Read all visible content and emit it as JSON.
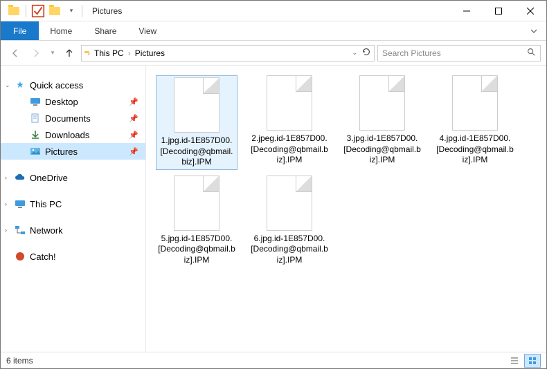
{
  "window": {
    "title": "Pictures"
  },
  "ribbon": {
    "file": "File",
    "tabs": [
      "Home",
      "Share",
      "View"
    ]
  },
  "breadcrumb": {
    "items": [
      "This PC",
      "Pictures"
    ]
  },
  "search": {
    "placeholder": "Search Pictures"
  },
  "tree": {
    "quick_access": {
      "label": "Quick access",
      "items": [
        {
          "label": "Desktop",
          "pinned": true
        },
        {
          "label": "Documents",
          "pinned": true
        },
        {
          "label": "Downloads",
          "pinned": true
        },
        {
          "label": "Pictures",
          "pinned": true,
          "selected": true
        }
      ]
    },
    "onedrive": {
      "label": "OneDrive"
    },
    "this_pc": {
      "label": "This PC"
    },
    "network": {
      "label": "Network"
    },
    "catch": {
      "label": "Catch!"
    }
  },
  "files": [
    {
      "name": "1.jpg.id-1E857D00.[Decoding@qbmail.biz].IPM"
    },
    {
      "name": "2.jpeg.id-1E857D00.[Decoding@qbmail.biz].IPM"
    },
    {
      "name": "3.jpg.id-1E857D00.[Decoding@qbmail.biz].IPM"
    },
    {
      "name": "4.jpg.id-1E857D00.[Decoding@qbmail.biz].IPM"
    },
    {
      "name": "5.jpg.id-1E857D00.[Decoding@qbmail.biz].IPM"
    },
    {
      "name": "6.jpg.id-1E857D00.[Decoding@qbmail.biz].IPM"
    }
  ],
  "status": {
    "item_count": "6 items"
  }
}
